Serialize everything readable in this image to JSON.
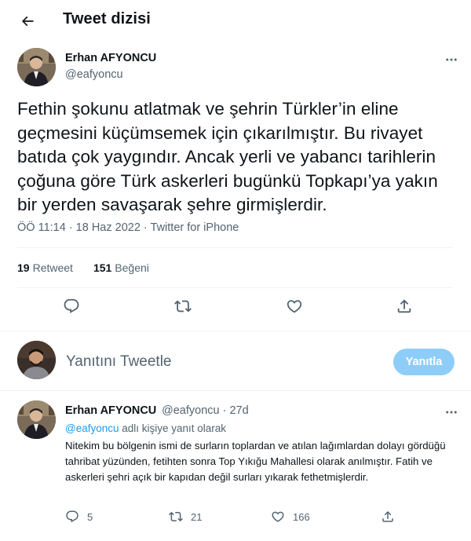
{
  "header": {
    "title": "Tweet dizisi",
    "back_icon": "arrow-left-icon"
  },
  "tweet": {
    "author_name": "Erhan AFYONCU",
    "author_handle": "@eafyoncu",
    "text": "Fethin şokunu atlatmak ve şehrin Türkler’in eline geçmesini küçümsemek için çıkarılmıştır. Bu rivayet batıda çok yaygındır. Ancak yerli ve yabancı tarihlerin çoğuna göre Türk askerleri bugünkü Topkapı’ya yakın bir yerden savaşarak şehre girmişlerdir.",
    "meta": "ÖÖ 11:14 · 18 Haz 2022 · Twitter for iPhone",
    "retweets": "19",
    "retweets_label": "Retweet",
    "likes": "151",
    "likes_label": "Beğeni"
  },
  "reply_box": {
    "placeholder": "Yanıtını Tweetle",
    "button_label": "Yanıtla"
  },
  "reply": {
    "author_name": "Erhan AFYONCU",
    "author_handle": "@eafyoncu · 27d",
    "context_handle": "@eafyoncu",
    "context_suffix": " adlı kişiye yanıt olarak",
    "text": "Nitekim bu bölgenin ismi de surların toplardan ve atılan lağımlardan dolayı gördüğü tahribat yüzünden, fetihten sonra Top Yıkığu Mahallesi olarak anılmıştır. Fatih ve askerleri şehri açık bir kapıdan değil surları yıkarak fethetmişlerdir.",
    "replies": "5",
    "retweets": "21",
    "likes": "166"
  },
  "colors": {
    "accent": "#1d9bf0",
    "muted": "#536471",
    "button_disabled": "#8ecdf8"
  }
}
